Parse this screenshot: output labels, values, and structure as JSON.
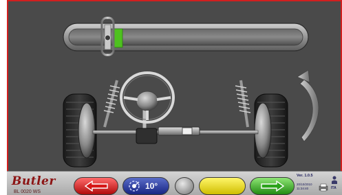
{
  "toolbar": {
    "angle_value": "10°"
  },
  "brand": {
    "name": "Butler",
    "model": "BL 0020 WS"
  },
  "status": {
    "version": "Ver. 1.0.5",
    "date": "20/10/2010",
    "time": "11:34:40",
    "language": "ITA"
  },
  "gauge": {
    "level": 0.1,
    "target_color": "#4ec11f"
  },
  "icons": {
    "back": "left-arrow-icon",
    "forward": "right-arrow-icon",
    "angle": "steering-angle-icon",
    "rotate": "rotate-arrow-icon",
    "printer": "printer-icon",
    "user": "user-icon"
  }
}
